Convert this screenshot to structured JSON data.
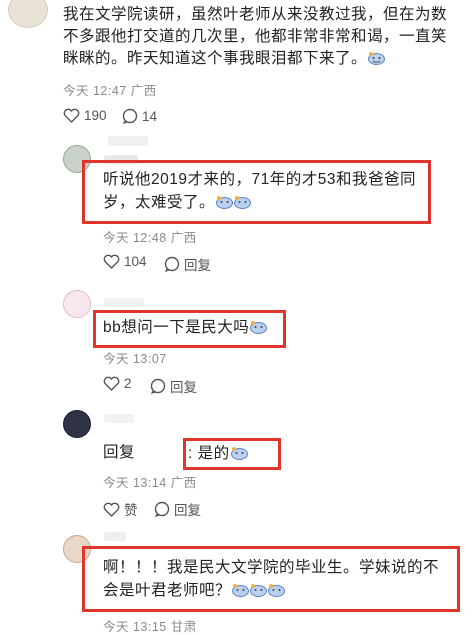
{
  "top_comment": {
    "text": "我在文学院读研，虽然叶老师从来没教过我，但在为数不多跟他打交道的几次里，他都非常非常和谒，一直笑眯眯的。昨天知道这个事我眼泪都下来了。",
    "time": "今天 12:47",
    "location": "广西",
    "likes": "190",
    "comments": "14"
  },
  "replies": [
    {
      "text": "听说他2019才来的，71年的才53和我爸爸同岁，太难受了。",
      "time": "今天 12:48",
      "location": "广西",
      "likes": "104",
      "reply_label": "回复"
    },
    {
      "text": "bb想问一下是民大吗",
      "time": "今天 13:07",
      "location": "",
      "likes": "2",
      "reply_label": "回复"
    },
    {
      "prefix": "回复",
      "text": ": 是的",
      "time": "今天 13:14",
      "location": "广西",
      "likes": "赞",
      "reply_label": "回复"
    },
    {
      "text": "啊！！！我是民大文学院的毕业生。学妹说的不会是叶君老师吧？",
      "time": "今天 13:15",
      "location": "甘肃"
    }
  ],
  "colors": {
    "highlight_border": "#e1352b",
    "meta_text": "#8a8a8a"
  },
  "icons": [
    "heart-icon",
    "comment-icon",
    "emoji-icon"
  ]
}
